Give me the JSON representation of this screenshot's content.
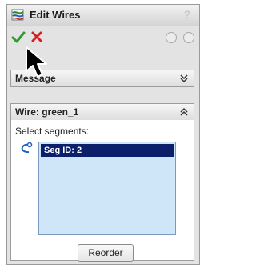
{
  "title_bar": {
    "title": "Edit Wires",
    "help_label": "?",
    "icon": "edit-wires-icon"
  },
  "actions": {
    "ok_icon": "checkmark-icon",
    "cancel_icon": "x-icon",
    "back_icon": "back-arrow-icon",
    "forward_icon": "forward-arrow-icon"
  },
  "message_group": {
    "title": "Message",
    "collapse_icon": "double-chevron-down-icon"
  },
  "wire_group": {
    "title": "Wire: green_1",
    "collapse_icon": "double-chevron-up-icon",
    "select_label": "Select segments:",
    "selection_icon": "segment-selection-icon",
    "segments": [
      "Seg ID: 2"
    ],
    "reorder_label": "Reorder"
  },
  "colors": {
    "ok_green": "#2e9b2e",
    "cancel_red": "#d42020",
    "selection_bg": "#0b1f6b",
    "list_bg": "#cfe5f8"
  }
}
